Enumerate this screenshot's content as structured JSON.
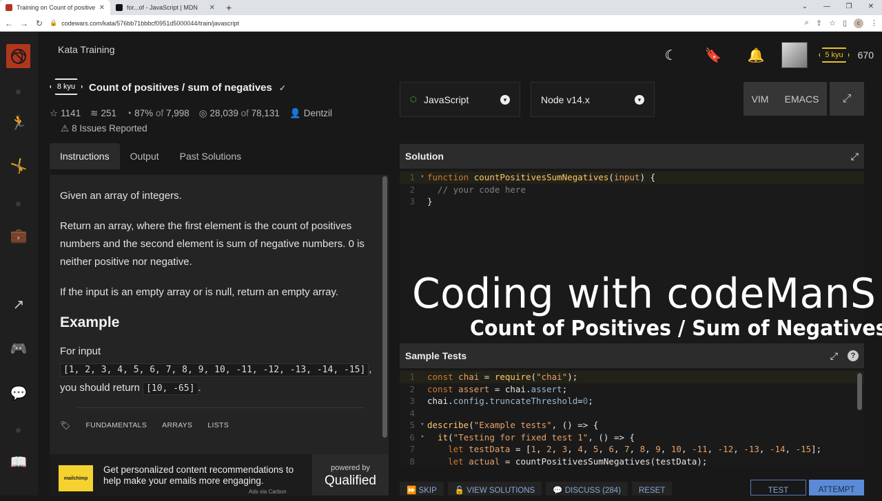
{
  "browser": {
    "tabs": [
      {
        "title": "Training on Count of positives / s",
        "active": true,
        "favicon_color": "#b1361e"
      },
      {
        "title": "for...of - JavaScript | MDN",
        "active": false,
        "favicon_color": "#111111"
      }
    ],
    "url": "codewars.com/kata/576bb71bbbcf0951d5000044/train/javascript"
  },
  "topbar": {
    "section_title": "Kata Training",
    "rank": "5 kyu",
    "honor": "670"
  },
  "kata": {
    "kyu": "8 kyu",
    "title": "Count of positives / sum of negatives",
    "stats": {
      "satisfaction": "1141",
      "collections": "251",
      "percent": "87%",
      "of_label": "of",
      "votes": "7,998",
      "completed": "28,039",
      "attempts": "78,131",
      "author": "Dentzil"
    },
    "issues": "8 Issues Reported"
  },
  "desc_tabs": [
    "Instructions",
    "Output",
    "Past Solutions"
  ],
  "description": {
    "p1": "Given an array of integers.",
    "p2": "Return an array, where the first element is the count of positives numbers and the second element is sum of negative numbers. 0 is neither positive nor negative.",
    "p3": "If the input is an empty array or is null, return an empty array.",
    "example_heading": "Example",
    "for_input": "For input",
    "input_code": "[1, 2, 3, 4, 5, 6, 7, 8, 9, 10, -11, -12, -13, -14, -15]",
    "comma": ",",
    "return_text": "you should return",
    "return_code": "[10, -65]",
    "period": ".",
    "tags": [
      "FUNDAMENTALS",
      "ARRAYS",
      "LISTS"
    ]
  },
  "ad": {
    "logo_text": "mailchimp",
    "text": "Get personalized content recommendations to help make your emails more engaging.",
    "by": "Ads via Carbon",
    "powered": "powered by",
    "brand": "Qualified"
  },
  "editor": {
    "language": "JavaScript",
    "version": "Node v14.x",
    "modes": [
      "VIM",
      "EMACS"
    ],
    "solution_title": "Solution",
    "tests_title": "Sample Tests"
  },
  "solution_code": [
    "function countPositivesSumNegatives(input) {",
    "  // your code here",
    "}"
  ],
  "tests_code": [
    "const chai = require(\"chai\");",
    "const assert = chai.assert;",
    "chai.config.truncateThreshold=0;",
    "",
    "describe(\"Example tests\", () => {",
    "  it(\"Testing for fixed test 1\", () => {",
    "    let testData = [1, 2, 3, 4, 5, 6, 7, 8, 9, 10, -11, -12, -13, -14, -15];",
    "    let actual = countPositivesSumNegatives(testData);"
  ],
  "overlay": {
    "line1": "Coding with codeManS",
    "line2": "Count of Positives / Sum of Negatives"
  },
  "actions": {
    "skip": "SKIP",
    "view_solutions": "VIEW SOLUTIONS",
    "discuss": "DISCUSS (284)",
    "reset": "RESET",
    "test": "TEST",
    "attempt": "ATTEMPT"
  },
  "colors": {
    "brand_red": "#b1361e",
    "rank_yellow": "#e6c229",
    "action_blue": "#5b8bd6"
  }
}
